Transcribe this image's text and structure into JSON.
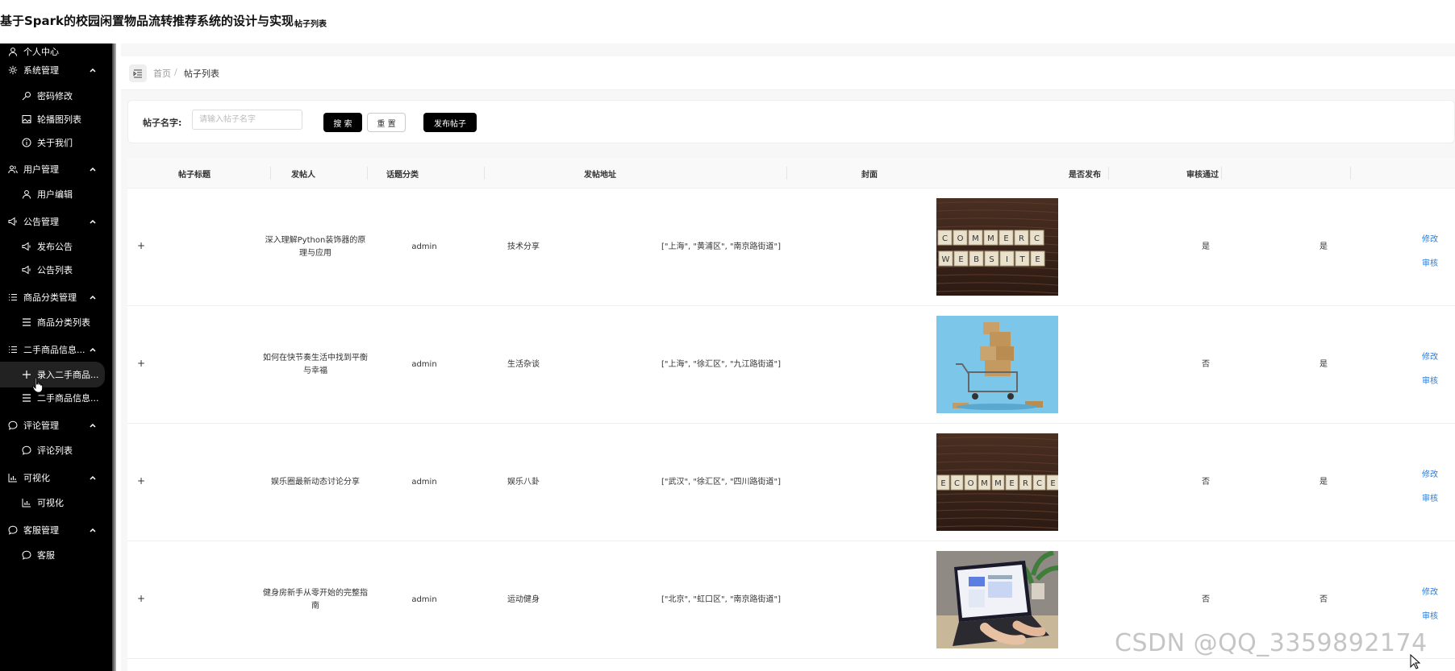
{
  "header": {
    "app_title": "基于Spark的校园闲置物品流转推荐系统的设计与实现",
    "page_subtitle": "帖子列表"
  },
  "sidebar": {
    "items": [
      {
        "label": "个人中心",
        "level": "top",
        "icon": "user-icon"
      },
      {
        "label": "系统管理",
        "level": "top",
        "icon": "gear-icon",
        "expanded": true
      },
      {
        "label": "密码修改",
        "level": "sub",
        "icon": "key-icon"
      },
      {
        "label": "轮播图列表",
        "level": "sub",
        "icon": "image-icon"
      },
      {
        "label": "关于我们",
        "level": "sub",
        "icon": "info-icon"
      },
      {
        "label": "用户管理",
        "level": "top",
        "icon": "users-icon",
        "expanded": true
      },
      {
        "label": "用户编辑",
        "level": "sub",
        "icon": "user-icon"
      },
      {
        "label": "公告管理",
        "level": "top",
        "icon": "speaker-icon",
        "expanded": true
      },
      {
        "label": "发布公告",
        "level": "sub",
        "icon": "speaker-icon"
      },
      {
        "label": "公告列表",
        "level": "sub",
        "icon": "speaker-icon"
      },
      {
        "label": "商品分类管理",
        "level": "top",
        "icon": "list-icon",
        "expanded": true
      },
      {
        "label": "商品分类列表",
        "level": "sub",
        "icon": "menu-icon"
      },
      {
        "label": "二手商品信息...",
        "level": "top",
        "icon": "list-icon",
        "expanded": true
      },
      {
        "label": "录入二手商品...",
        "level": "sub",
        "icon": "plus-icon",
        "active": true
      },
      {
        "label": "二手商品信息...",
        "level": "sub",
        "icon": "menu-icon"
      },
      {
        "label": "评论管理",
        "level": "top",
        "icon": "chat-icon",
        "expanded": true
      },
      {
        "label": "评论列表",
        "level": "sub",
        "icon": "chat-icon"
      },
      {
        "label": "可视化",
        "level": "top",
        "icon": "chart-icon",
        "expanded": true
      },
      {
        "label": "可视化",
        "level": "sub",
        "icon": "chart-icon"
      },
      {
        "label": "客服管理",
        "level": "top",
        "icon": "chat-icon",
        "expanded": true
      },
      {
        "label": "客服",
        "level": "sub",
        "icon": "chat-icon"
      }
    ]
  },
  "breadcrumb": {
    "home": "首页",
    "separator": "/",
    "current": "帖子列表"
  },
  "search": {
    "label": "帖子名字:",
    "placeholder": "请输入帖子名字",
    "value": "",
    "search_label": "搜 索",
    "reset_label": "重 置",
    "publish_label": "发布帖子"
  },
  "table": {
    "columns": [
      "帖子标题",
      "发帖人",
      "话题分类",
      "发帖地址",
      "封面",
      "是否发布",
      "审核通过"
    ],
    "rows": [
      {
        "expand": "+",
        "title": "深入理解Python装饰器的原理与应用",
        "author": "admin",
        "topic": "技术分享",
        "address": "[\"上海\", \"黄浦区\", \"南京路街道\"]",
        "cover": "ecommerce-website-tiles",
        "published": "是",
        "approved": "是",
        "edit": "修改",
        "review": "审核"
      },
      {
        "expand": "+",
        "title": "如何在快节奏生活中找到平衡与幸福",
        "author": "admin",
        "topic": "生活杂谈",
        "address": "[\"上海\", \"徐汇区\", \"九江路街道\"]",
        "cover": "shopping-cart-boxes",
        "published": "否",
        "approved": "是",
        "edit": "修改",
        "review": "审核"
      },
      {
        "expand": "+",
        "title": "娱乐圈最新动态讨论分享",
        "author": "admin",
        "topic": "娱乐八卦",
        "address": "[\"武汉\", \"徐汇区\", \"四川路街道\"]",
        "cover": "ecommerce-tiles",
        "published": "否",
        "approved": "是",
        "edit": "修改",
        "review": "审核"
      },
      {
        "expand": "+",
        "title": "健身房新手从零开始的完整指南",
        "author": "admin",
        "topic": "运动健身",
        "address": "[\"北京\", \"虹口区\", \"南京路街道\"]",
        "cover": "laptop-dashboard",
        "published": "否",
        "approved": "否",
        "edit": "修改",
        "review": "审核"
      }
    ]
  },
  "watermark": "CSDN @QQ_3359892174",
  "colors": {
    "sidebar_bg": "#000000",
    "link": "#2b7bd8",
    "button_dark": "#000000"
  }
}
